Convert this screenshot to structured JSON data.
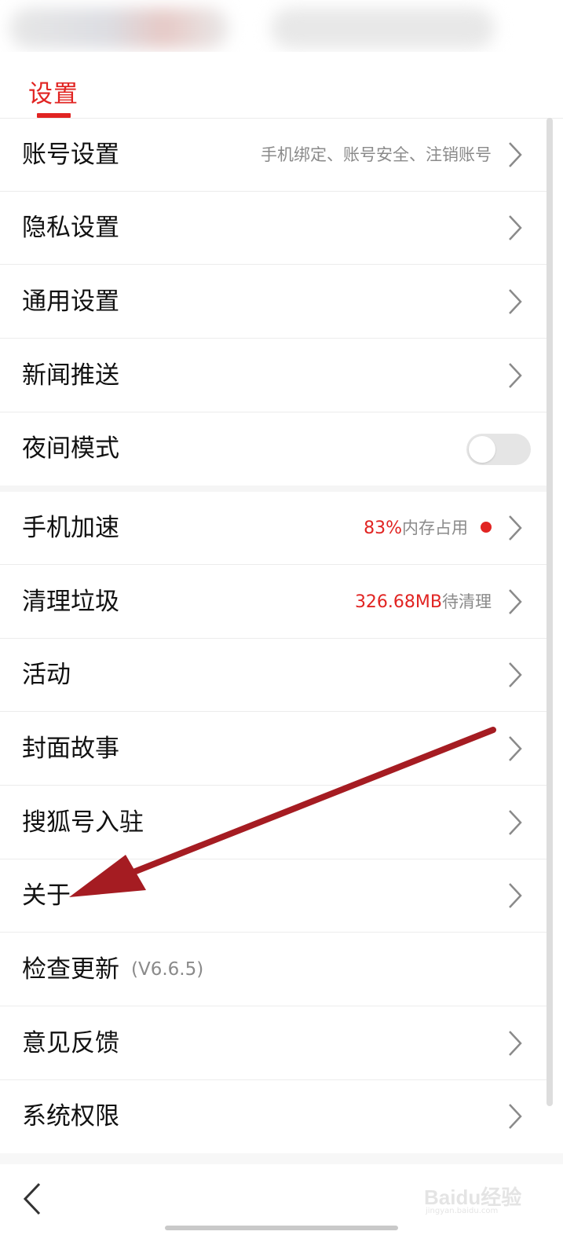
{
  "tabs": {
    "active": "设置"
  },
  "group1": [
    {
      "label": "账号设置",
      "detail": "手机绑定、账号安全、注销账号"
    },
    {
      "label": "隐私设置"
    },
    {
      "label": "通用设置"
    },
    {
      "label": "新闻推送"
    },
    {
      "label": "夜间模式",
      "toggle_on": false
    }
  ],
  "group2": [
    {
      "label": "手机加速",
      "highlight": "83%",
      "detail": "内存占用",
      "has_dot": true
    },
    {
      "label": "清理垃圾",
      "highlight": "326.68MB",
      "detail": "待清理"
    },
    {
      "label": "活动"
    },
    {
      "label": "封面故事"
    },
    {
      "label": "搜狐号入驻"
    },
    {
      "label": "关于"
    },
    {
      "label": "检查更新",
      "version": "(V6.6.5)"
    },
    {
      "label": "意见反馈"
    },
    {
      "label": "系统权限"
    }
  ],
  "watermark": {
    "text": "Baidu经验",
    "sub": "jingyan.baidu.com"
  },
  "colors": {
    "accent": "#e12422",
    "annotation_arrow": "#a51c22"
  },
  "icons": {
    "chevron": "chevron-right-icon",
    "back": "back-arrow-icon"
  }
}
